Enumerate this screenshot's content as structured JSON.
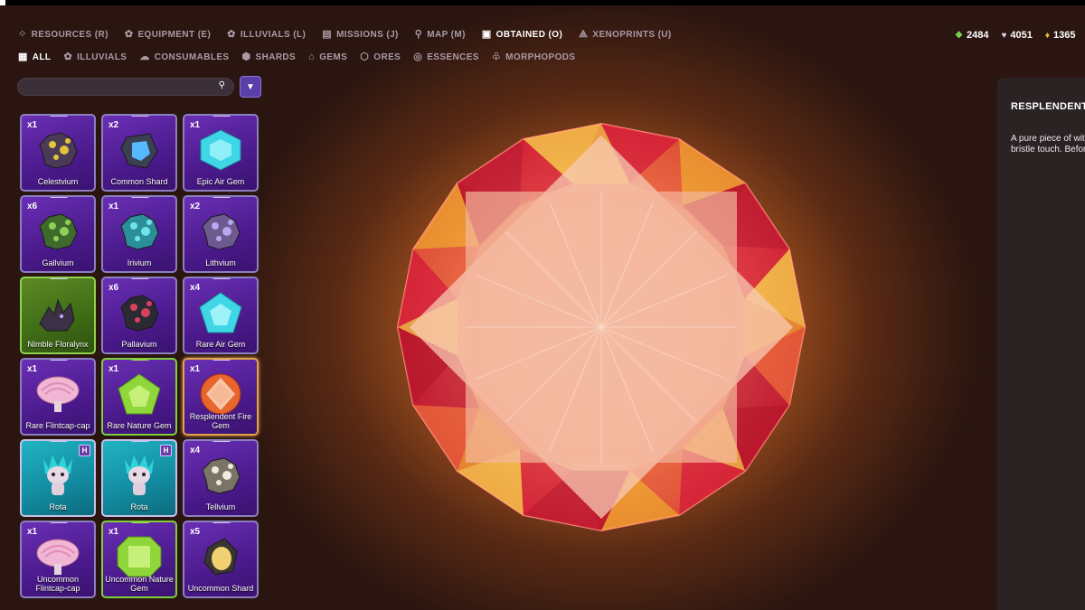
{
  "nav_primary": [
    {
      "icon": "resources-icon",
      "glyph": "⁘",
      "label": "RESOURCES (R)",
      "active": false
    },
    {
      "icon": "equipment-icon",
      "glyph": "✿",
      "label": "EQUIPMENT (E)",
      "active": false
    },
    {
      "icon": "illuvials-icon",
      "glyph": "✿",
      "label": "ILLUVIALS (L)",
      "active": false
    },
    {
      "icon": "missions-icon",
      "glyph": "▤",
      "label": "MISSIONS (J)",
      "active": false
    },
    {
      "icon": "map-icon",
      "glyph": "⚲",
      "label": "MAP (M)",
      "active": false
    },
    {
      "icon": "obtained-icon",
      "glyph": "▣",
      "label": "OBTAINED (O)",
      "active": true
    },
    {
      "icon": "xenoprints-icon",
      "glyph": "⟁",
      "label": "XENOPRINTS (U)",
      "active": false
    }
  ],
  "nav_secondary": [
    {
      "icon": "grid-icon",
      "glyph": "▦",
      "label": "ALL",
      "active": true
    },
    {
      "icon": "illuvials-icon",
      "glyph": "✿",
      "label": "ILLUVIALS",
      "active": false
    },
    {
      "icon": "consumables-icon",
      "glyph": "☁",
      "label": "CONSUMABLES",
      "active": false
    },
    {
      "icon": "shards-icon",
      "glyph": "⬢",
      "label": "SHARDS",
      "active": false
    },
    {
      "icon": "gems-icon",
      "glyph": "⌂",
      "label": "GEMS",
      "active": false
    },
    {
      "icon": "ores-icon",
      "glyph": "⬡",
      "label": "ORES",
      "active": false
    },
    {
      "icon": "essences-icon",
      "glyph": "◎",
      "label": "ESSENCES",
      "active": false
    },
    {
      "icon": "morphopods-icon",
      "glyph": "♧",
      "label": "MORPHOPODS",
      "active": false
    }
  ],
  "currencies": [
    {
      "icon": "green-crystal-icon",
      "glyph": "❖",
      "color": "#7ed957",
      "value": "2484"
    },
    {
      "icon": "heart-icon",
      "glyph": "♥",
      "color": "#d9d4e8",
      "value": "4051"
    },
    {
      "icon": "gold-icon",
      "glyph": "♦",
      "color": "#f0c233",
      "value": "1365"
    }
  ],
  "search": {
    "value": "",
    "placeholder": ""
  },
  "items": [
    {
      "qty": "x1",
      "name": "Celestvium",
      "style": "purple",
      "art": "ore-gold",
      "badge": ""
    },
    {
      "qty": "x2",
      "name": "Common Shard",
      "style": "purple",
      "art": "shard-blue",
      "badge": ""
    },
    {
      "qty": "x1",
      "name": "Epic Air Gem",
      "style": "purple",
      "art": "gem-cyan-hex",
      "badge": ""
    },
    {
      "qty": "x6",
      "name": "Gallvium",
      "style": "purple",
      "art": "ore-green",
      "badge": ""
    },
    {
      "qty": "x1",
      "name": "Irivium",
      "style": "purple",
      "art": "ore-teal",
      "badge": ""
    },
    {
      "qty": "x2",
      "name": "Lithvium",
      "style": "purple",
      "art": "ore-lavender",
      "badge": ""
    },
    {
      "qty": "",
      "name": "Nimble Floralynx",
      "style": "natural",
      "art": "creature-dark",
      "badge": ""
    },
    {
      "qty": "x6",
      "name": "Pallavium",
      "style": "purple",
      "art": "ore-red",
      "badge": ""
    },
    {
      "qty": "x4",
      "name": "Rare Air Gem",
      "style": "purple",
      "art": "gem-cyan-pent",
      "badge": ""
    },
    {
      "qty": "x1",
      "name": "Rare Flintcap-cap",
      "style": "purple",
      "art": "mushroom-pink",
      "badge": ""
    },
    {
      "qty": "x1",
      "name": "Rare Nature Gem",
      "style": "green",
      "art": "gem-green-pent",
      "badge": ""
    },
    {
      "qty": "x1",
      "name": "Resplendent Fire Gem",
      "style": "selected",
      "art": "gem-fire",
      "badge": ""
    },
    {
      "qty": "",
      "name": "Rota",
      "style": "teal",
      "art": "creature-rota",
      "badge": "H"
    },
    {
      "qty": "",
      "name": "Rota",
      "style": "teal",
      "art": "creature-rota",
      "badge": "H"
    },
    {
      "qty": "x4",
      "name": "Tellvium",
      "style": "purple",
      "art": "ore-white",
      "badge": ""
    },
    {
      "qty": "x1",
      "name": "Uncommon Flintcap-cap",
      "style": "purple",
      "art": "mushroom-pink",
      "badge": ""
    },
    {
      "qty": "x1",
      "name": "Uncommon Nature Gem",
      "style": "green",
      "art": "gem-green-oct",
      "badge": ""
    },
    {
      "qty": "x5",
      "name": "Uncommon Shard",
      "style": "purple",
      "art": "shard-gold",
      "badge": ""
    }
  ],
  "detail": {
    "title": "RESPLENDENT",
    "description": "A pure piece of with radiant, c bands. It bristle touch. Before it it with the pow Illuvial."
  }
}
